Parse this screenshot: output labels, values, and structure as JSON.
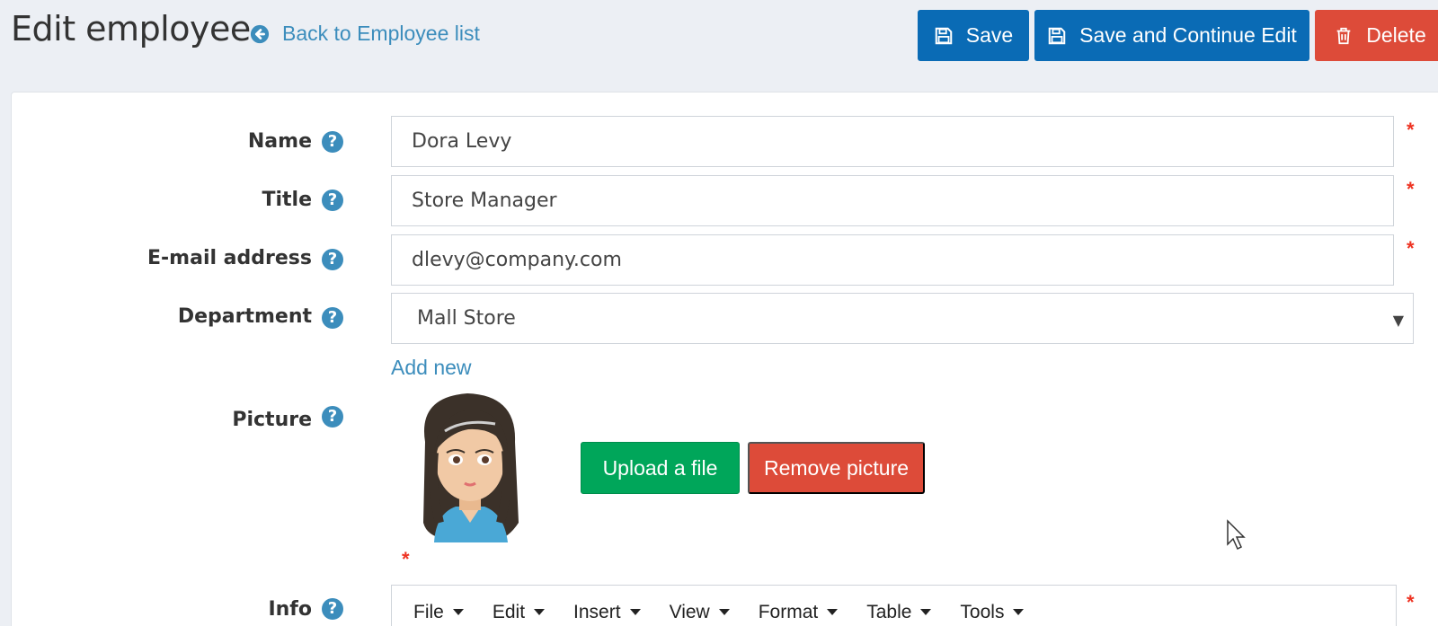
{
  "header": {
    "title": "Edit employee",
    "back_link": "Back to Employee list",
    "save_label": "Save",
    "save_continue_label": "Save and Continue Edit",
    "delete_label": "Delete"
  },
  "form": {
    "name": {
      "label": "Name",
      "value": "Dora Levy",
      "required": true
    },
    "title": {
      "label": "Title",
      "value": "Store Manager",
      "required": true
    },
    "email": {
      "label": "E-mail address",
      "value": "dlevy@company.com",
      "required": true
    },
    "department": {
      "label": "Department",
      "value": "Mall Store"
    },
    "add_new": "Add new",
    "picture": {
      "label": "Picture",
      "upload_label": "Upload a file",
      "remove_label": "Remove picture",
      "required": true
    },
    "info": {
      "label": "Info",
      "menu": [
        "File",
        "Edit",
        "Insert",
        "View",
        "Format",
        "Table",
        "Tools"
      ],
      "required": true
    }
  },
  "help_glyph": "?",
  "required_glyph": "*",
  "colors": {
    "primary": "#0a6bb5",
    "danger": "#dd4b39",
    "success": "#00a65a",
    "link": "#3c8dbc",
    "required": "#e32"
  }
}
